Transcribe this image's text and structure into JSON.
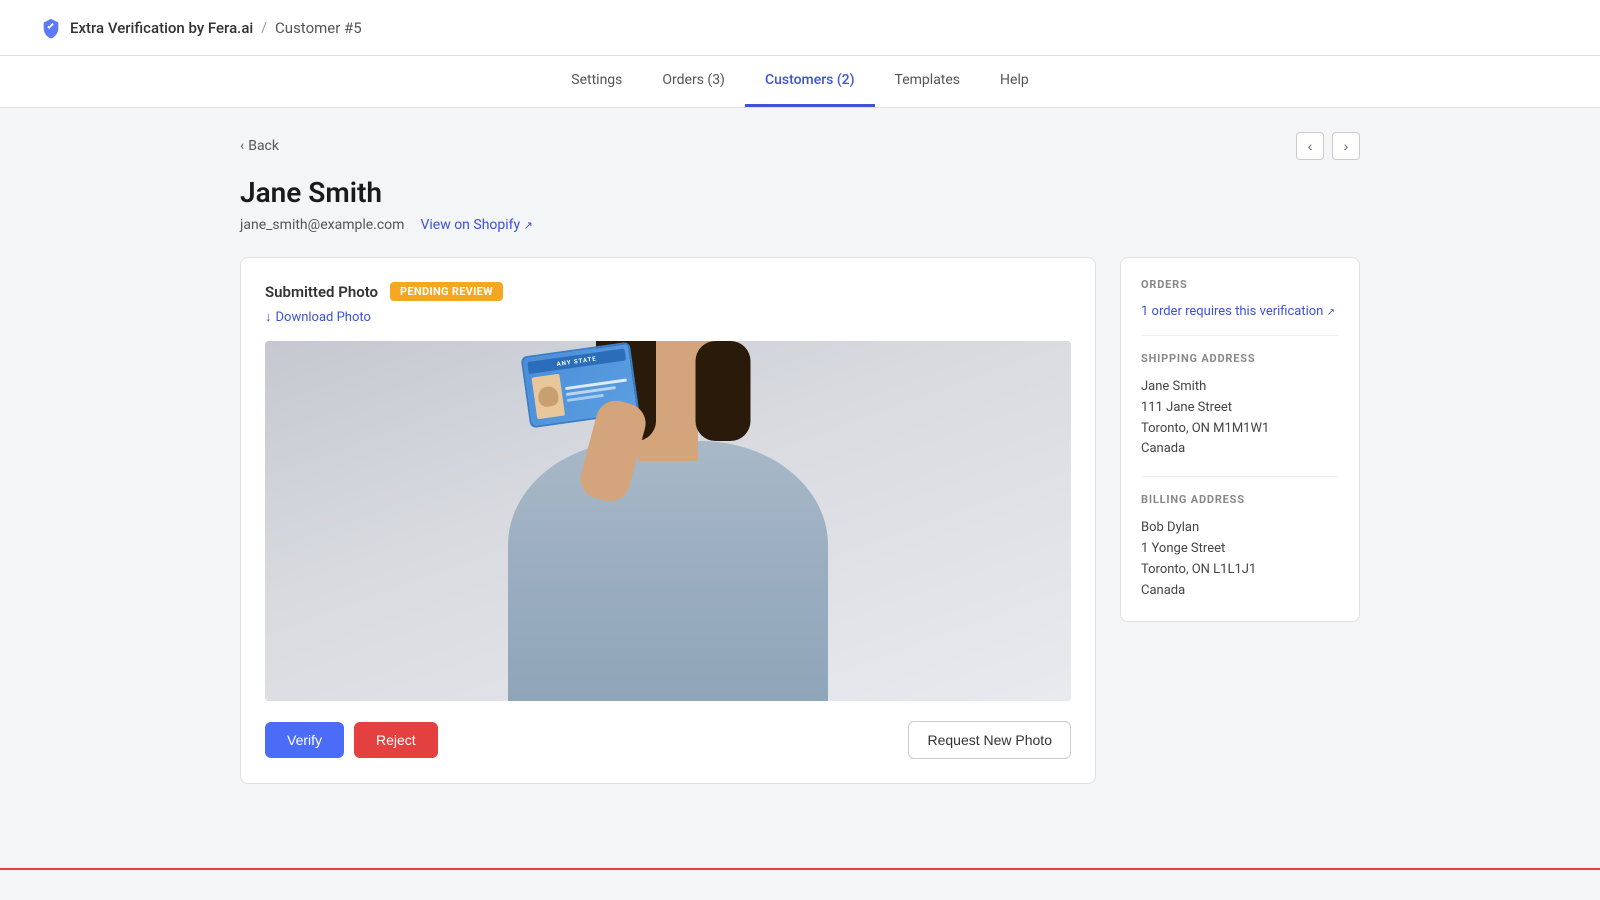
{
  "header": {
    "brand_name": "Extra Verification by Fera.ai",
    "separator": "/",
    "current_page": "Customer #5"
  },
  "nav": {
    "items": [
      {
        "label": "Settings",
        "active": false,
        "badge": null
      },
      {
        "label": "Orders (3)",
        "active": false,
        "badge": "3"
      },
      {
        "label": "Customers (2)",
        "active": true,
        "badge": "2"
      },
      {
        "label": "Templates",
        "active": false,
        "badge": null
      },
      {
        "label": "Help",
        "active": false,
        "badge": null
      }
    ]
  },
  "back_link": "Back",
  "customer": {
    "name": "Jane Smith",
    "email": "jane_smith@example.com",
    "view_shopify_label": "View on Shopify"
  },
  "photo_card": {
    "title": "Submitted Photo",
    "status": "Pending Review",
    "download_label": "Download Photo",
    "btn_verify": "Verify",
    "btn_reject": "Reject",
    "btn_request": "Request New Photo"
  },
  "sidebar": {
    "orders_title": "ORDERS",
    "orders_link": "1 order requires this verification",
    "shipping_title": "SHIPPING ADDRESS",
    "shipping": {
      "name": "Jane Smith",
      "street": "111 Jane Street",
      "city_state": "Toronto, ON M1M1W1",
      "country": "Canada"
    },
    "billing_title": "BILLING ADDRESS",
    "billing": {
      "name": "Bob Dylan",
      "street": "1 Yonge Street",
      "city_state": "Toronto, ON L1L1J1",
      "country": "Canada"
    }
  }
}
